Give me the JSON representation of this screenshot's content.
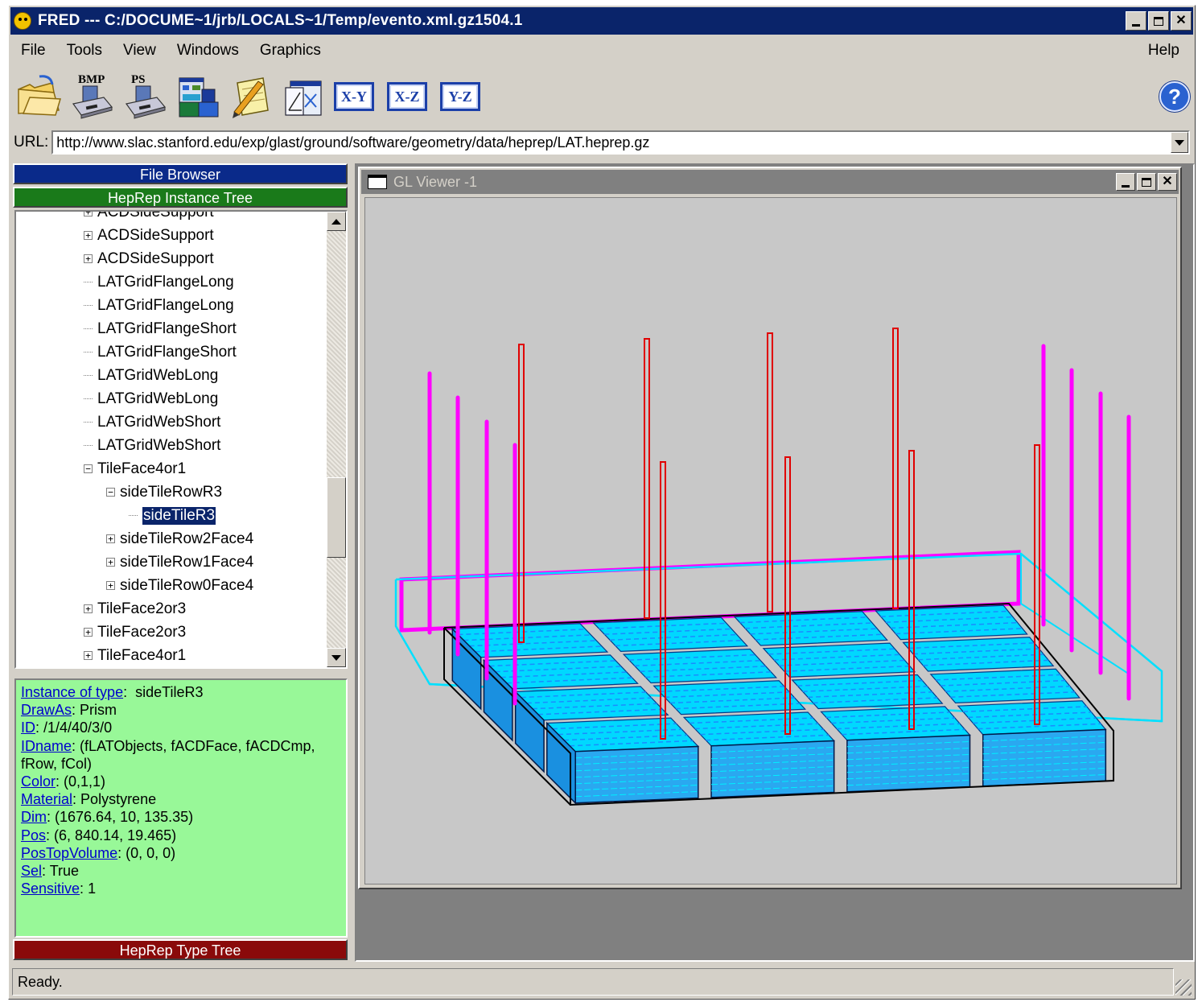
{
  "window": {
    "title": "FRED --- C:/DOCUME~1/jrb/LOCALS~1/Temp/evento.xml.gz1504.1"
  },
  "menu": {
    "items": [
      "File",
      "Tools",
      "View",
      "Windows",
      "Graphics"
    ],
    "help": "Help"
  },
  "toolbar": {
    "bmp_label": "BMP",
    "ps_label": "PS",
    "xy_label": "X-Y",
    "xz_label": "X-Z",
    "yz_label": "Y-Z",
    "help_symbol": "?"
  },
  "url": {
    "label": "URL:",
    "value": "http://www.slac.stanford.edu/exp/glast/ground/software/geometry/data/heprep/LAT.heprep.gz"
  },
  "left_panel": {
    "file_browser": "File Browser",
    "instance_tree": "HepRep Instance Tree",
    "type_tree": "HepRep Type Tree"
  },
  "tree": {
    "nodes": [
      {
        "label": "ACDSideSupport",
        "expander": "+",
        "level": 0
      },
      {
        "label": "ACDSideSupport",
        "expander": "+",
        "level": 0
      },
      {
        "label": "ACDSideSupport",
        "expander": "+",
        "level": 0
      },
      {
        "label": "LATGridFlangeLong",
        "expander": "",
        "level": 0
      },
      {
        "label": "LATGridFlangeLong",
        "expander": "",
        "level": 0
      },
      {
        "label": "LATGridFlangeShort",
        "expander": "",
        "level": 0
      },
      {
        "label": "LATGridFlangeShort",
        "expander": "",
        "level": 0
      },
      {
        "label": "LATGridWebLong",
        "expander": "",
        "level": 0
      },
      {
        "label": "LATGridWebLong",
        "expander": "",
        "level": 0
      },
      {
        "label": "LATGridWebShort",
        "expander": "",
        "level": 0
      },
      {
        "label": "LATGridWebShort",
        "expander": "",
        "level": 0
      },
      {
        "label": "TileFace4or1",
        "expander": "−",
        "level": 0
      },
      {
        "label": "sideTileRowR3",
        "expander": "−",
        "level": 1
      },
      {
        "label": "sideTileR3",
        "expander": "",
        "level": 2,
        "selected": true
      },
      {
        "label": "sideTileRow2Face4",
        "expander": "+",
        "level": 1
      },
      {
        "label": "sideTileRow1Face4",
        "expander": "+",
        "level": 1
      },
      {
        "label": "sideTileRow0Face4",
        "expander": "+",
        "level": 1
      },
      {
        "label": "TileFace2or3",
        "expander": "+",
        "level": 0
      },
      {
        "label": "TileFace2or3",
        "expander": "+",
        "level": 0
      },
      {
        "label": "TileFace4or1",
        "expander": "+",
        "level": 0
      }
    ]
  },
  "properties": [
    {
      "key": "Instance of type",
      "sep": ":  ",
      "value": "sideTileR3"
    },
    {
      "key": "DrawAs",
      "sep": ": ",
      "value": "Prism"
    },
    {
      "key": "ID",
      "sep": ": ",
      "value": "/1/4/40/3/0"
    },
    {
      "key": "IDname",
      "sep": ": ",
      "value": "(fLATObjects, fACDFace, fACDCmp, fRow, fCol)"
    },
    {
      "key": "Color",
      "sep": ": ",
      "value": "(0,1,1)"
    },
    {
      "key": "Material",
      "sep": ": ",
      "value": "Polystyrene"
    },
    {
      "key": "Dim",
      "sep": ": ",
      "value": "(1676.64, 10, 135.35)"
    },
    {
      "key": "Pos",
      "sep": ": ",
      "value": "(6, 840.14, 19.465)"
    },
    {
      "key": "PosTopVolume",
      "sep": ": ",
      "value": "(0, 0, 0)"
    },
    {
      "key": "Sel",
      "sep": ": ",
      "value": "True"
    },
    {
      "key": "Sensitive",
      "sep": ": ",
      "value": "1"
    }
  ],
  "viewer": {
    "title": "GL Viewer -1"
  },
  "colors": {
    "magenta": "#ff00ff",
    "red": "#e00000",
    "cyan": "#00e0ff",
    "tile_blue": "#1a8cff",
    "viewer_bg": "#c8c8c8"
  },
  "status": {
    "text": "Ready."
  }
}
